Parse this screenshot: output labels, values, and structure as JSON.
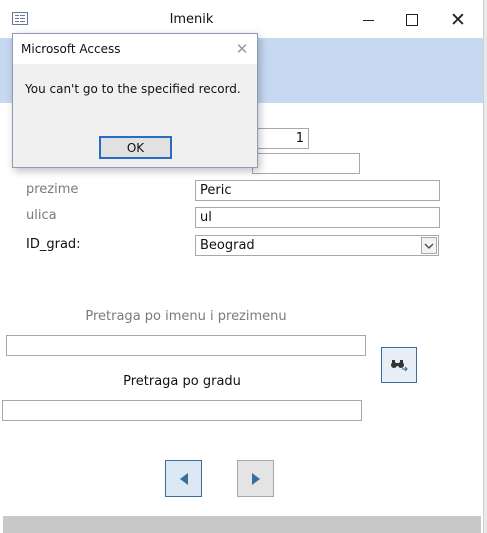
{
  "window": {
    "title": "Imenik",
    "icons": {
      "app": "form-icon",
      "minimize": "minimize-icon",
      "maximize": "maximize-icon",
      "close": "close-icon"
    }
  },
  "form": {
    "id_value": "1",
    "ime_value": "",
    "prezime_label": "prezime",
    "prezime_value": "Peric",
    "ulica_label": "ulica",
    "ulica_value": "ul",
    "grad_label": "ID_grad:",
    "grad_value": "Beograd"
  },
  "search": {
    "name_label": "Pretraga po imenu i prezimenu",
    "name_value": "",
    "city_label": "Pretraga po gradu",
    "city_value": "",
    "button_icon": "binoculars-icon"
  },
  "navigation": {
    "prev_icon": "triangle-left-icon",
    "next_icon": "triangle-right-icon"
  },
  "dialog": {
    "title": "Microsoft Access",
    "message": "You can't go to the specified record.",
    "ok_label": "OK"
  },
  "colors": {
    "header_band": "#c6d9f1",
    "accent": "#2a6cc4",
    "nav_arrow": "#3b6e9c"
  }
}
